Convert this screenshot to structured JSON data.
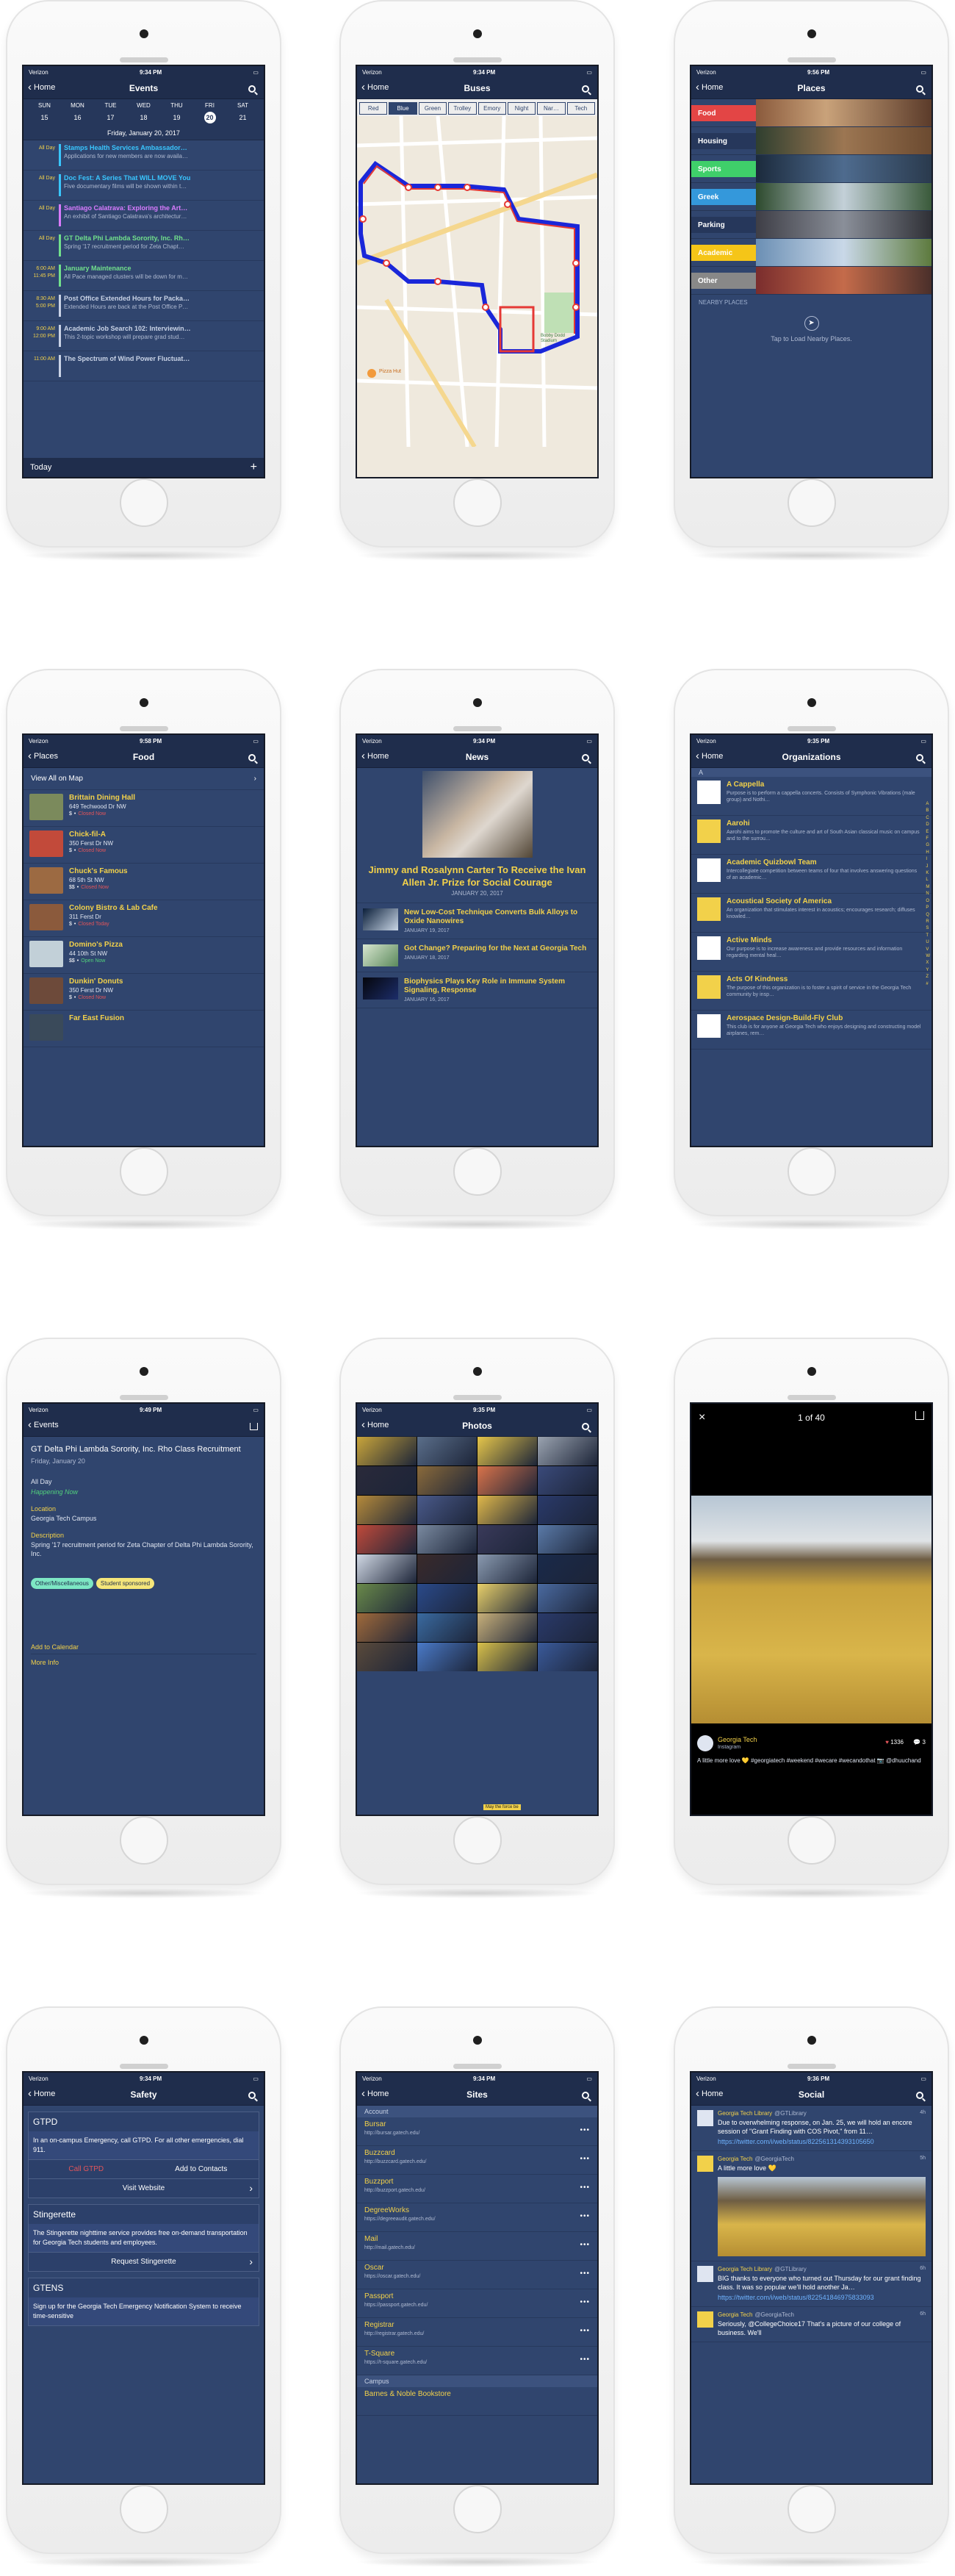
{
  "status": {
    "carrier": "Verizon",
    "times": [
      "9:34 PM",
      "9:34 PM",
      "9:56 PM",
      "9:58 PM",
      "9:34 PM",
      "9:35 PM",
      "9:49 PM",
      "9:35 PM",
      "",
      "9:34 PM",
      "9:34 PM",
      "9:36 PM"
    ]
  },
  "events": {
    "back": "Home",
    "title": "Events",
    "days": [
      "SUN",
      "MON",
      "TUE",
      "WED",
      "THU",
      "FRI",
      "SAT"
    ],
    "nums": [
      "15",
      "16",
      "17",
      "18",
      "19",
      "20",
      "21"
    ],
    "date": "Friday, January 20, 2017",
    "items": [
      {
        "time": "All Day",
        "title": "Stamps Health Services Ambassador…",
        "desc": "Applications for new members are now availa…",
        "color": "#39c6ff"
      },
      {
        "time": "All Day",
        "title": "Doc Fest: A Series That WILL MOVE You",
        "desc": "Five documentary films will be shown within t…",
        "color": "#39c6ff"
      },
      {
        "time": "All Day",
        "title": "Santiago Calatrava: Exploring the Art…",
        "desc": "An exhibit of Santiago Calatrava's architectur…",
        "color": "#d97bff"
      },
      {
        "time": "All Day",
        "title": "GT Delta Phi Lambda Sorority, Inc. Rh…",
        "desc": "Spring '17 recruitment period for Zeta Chapt…",
        "color": "#71e08c"
      },
      {
        "time": "6:00 AM\n11:45 PM",
        "title": "January Maintenance",
        "desc": "All Pace managed clusters will be down for m…",
        "color": "#71e08c"
      },
      {
        "time": "8:30 AM\n5:00 PM",
        "title": "Post Office Extended Hours for Packa…",
        "desc": "Extended Hours are back at the Post Office P…",
        "color": "#c9d3e6"
      },
      {
        "time": "9:00 AM\n12:00 PM",
        "title": "Academic Job Search 102: Interviewin…",
        "desc": "This 2-topic workshop will prepare grad stud…",
        "color": "#c9d3e6"
      },
      {
        "time": "11:00 AM",
        "title": "The Spectrum of Wind Power Fluctuat…",
        "desc": "",
        "color": "#c9d3e6"
      }
    ],
    "today": "Today",
    "add": "+"
  },
  "buses": {
    "back": "Home",
    "title": "Buses",
    "tabs": [
      "Red",
      "Blue",
      "Green",
      "Trolley",
      "Emory",
      "Night",
      "Nar…",
      "Tech"
    ],
    "active": "Blue",
    "map_labels": [
      "Pizza Hut",
      "Bobby Dodd Stadium"
    ]
  },
  "places": {
    "back": "Home",
    "title": "Places",
    "items": [
      {
        "label": "Food",
        "color": "#e34545"
      },
      {
        "label": "Housing",
        "color": "#26375b"
      },
      {
        "label": "Sports",
        "color": "#3fcf6a"
      },
      {
        "label": "Greek",
        "color": "#3498db"
      },
      {
        "label": "Parking",
        "color": "#26375b"
      },
      {
        "label": "Academic",
        "color": "#f5c518"
      },
      {
        "label": "Other",
        "color": "#888888"
      }
    ],
    "nearby": "NEARBY PLACES",
    "tap": "Tap to Load Nearby Places."
  },
  "food": {
    "back": "Places",
    "title": "Food",
    "view_all": "View All on Map",
    "items": [
      {
        "name": "Brittain Dining Hall",
        "addr": "649 Techwood Dr NW",
        "price": "$",
        "status": "Closed Now",
        "open": false
      },
      {
        "name": "Chick-fil-A",
        "addr": "350 Ferst Dr NW",
        "price": "$",
        "status": "Closed Now",
        "open": false
      },
      {
        "name": "Chuck's Famous",
        "addr": "68 5th St NW",
        "price": "$$",
        "status": "Closed Now",
        "open": false
      },
      {
        "name": "Colony Bistro & Lab Cafe",
        "addr": "311 Ferst Dr",
        "price": "$",
        "status": "Closed Today",
        "open": false
      },
      {
        "name": "Domino's Pizza",
        "addr": "44 10th St NW",
        "price": "$$",
        "status": "Open Now",
        "open": true
      },
      {
        "name": "Dunkin' Donuts",
        "addr": "350 Ferst Dr NW",
        "price": "$",
        "status": "Closed Now",
        "open": false
      },
      {
        "name": "Far East Fusion",
        "addr": "",
        "price": "",
        "status": "",
        "open": false
      }
    ]
  },
  "news": {
    "back": "Home",
    "title": "News",
    "hero_title": "Jimmy and Rosalynn Carter To Receive the Ivan Allen Jr. Prize for Social Courage",
    "hero_date": "JANUARY 20, 2017",
    "items": [
      {
        "title": "New Low-Cost Technique Converts Bulk Alloys to Oxide Nanowires",
        "date": "JANUARY 19, 2017"
      },
      {
        "title": "Got Change? Preparing for the Next at Georgia Tech",
        "date": "JANUARY 18, 2017"
      },
      {
        "title": "Biophysics Plays Key Role in Immune System Signaling, Response",
        "date": "JANUARY 16, 2017"
      }
    ]
  },
  "orgs": {
    "back": "Home",
    "title": "Organizations",
    "section": "A",
    "az": [
      "A",
      "B",
      "C",
      "D",
      "E",
      "F",
      "G",
      "H",
      "I",
      "J",
      "K",
      "L",
      "M",
      "N",
      "O",
      "P",
      "Q",
      "R",
      "S",
      "T",
      "U",
      "V",
      "W",
      "X",
      "Y",
      "Z",
      "#"
    ],
    "items": [
      {
        "name": "A Cappella",
        "desc": "Purpose is to perform a cappella concerts. Consists of Symphonic Vibrations (male group) and Nothi…"
      },
      {
        "name": "Aarohi",
        "desc": "Aarohi aims to promote the culture and art of South Asian classical music on campus and to the surrou…"
      },
      {
        "name": "Academic Quizbowl Team",
        "desc": "Intercollegiate competition between teams of four that involves answering questions of an academic…"
      },
      {
        "name": "Acoustical Society of America",
        "desc": "An organization that stimulates interest in acoustics; encourages research; diffuses knowled…"
      },
      {
        "name": "Active Minds",
        "desc": "Our purpose is to increase awareness and provide resources and information regarding mental heal…"
      },
      {
        "name": "Acts Of Kindness",
        "desc": "The purpose of this organization is to foster a spirit of service in the Georgia Tech community by insp…"
      },
      {
        "name": "Aerospace Design-Build-Fly Club",
        "desc": "This club is for anyone at Georgia Tech who enjoys designing and constructing model airplanes, rem…"
      }
    ]
  },
  "detail": {
    "back": "Events",
    "title": "GT Delta Phi Lambda Sorority, Inc. Rho Class Recruitment",
    "date": "Friday, January 20",
    "when": "All Day",
    "happening": "Happening Now",
    "loc_label": "Location",
    "loc": "Georgia Tech Campus",
    "desc_label": "Description",
    "desc": "Spring '17 recruitment period for Zeta Chapter of Delta Phi Lambda Sorority, Inc.",
    "tags": [
      "Other/Miscellaneous",
      "Student sponsored"
    ],
    "add_cal": "Add to Calendar",
    "more": "More Info"
  },
  "photos": {
    "back": "Home",
    "title": "Photos",
    "caption": "May the force be"
  },
  "viewer": {
    "counter": "1 of 40",
    "user": "Georgia Tech",
    "source": "Instagram",
    "likes": "1336",
    "comments": "3",
    "caption": "A little more love 💛 #georgiatech #weekend #wecare #wecandothat 📷 @dhuuchand"
  },
  "safety": {
    "back": "Home",
    "title": "Safety",
    "cards": [
      {
        "head": "GTPD",
        "body": "In an on-campus Emergency, call GTPD. For all other emergencies, dial 911.",
        "btn1": "Call GTPD",
        "btn2": "Add to Contacts",
        "action": "Visit Website"
      },
      {
        "head": "Stingerette",
        "body": "The Stingerette nighttime service provides free on-demand transportation for Georgia Tech students and employees.",
        "action": "Request Stingerette"
      },
      {
        "head": "GTENS",
        "body": "Sign up for the Georgia Tech Emergency Notification System to receive time-sensitive"
      }
    ]
  },
  "sites": {
    "back": "Home",
    "title": "Sites",
    "group1": "Account",
    "group2": "Campus",
    "items": [
      {
        "name": "Bursar",
        "url": "http://bursar.gatech.edu/"
      },
      {
        "name": "Buzzcard",
        "url": "http://buzzcard.gatech.edu/"
      },
      {
        "name": "Buzzport",
        "url": "http://buzzport.gatech.edu/"
      },
      {
        "name": "DegreeWorks",
        "url": "https://degreeaudit.gatech.edu/"
      },
      {
        "name": "Mail",
        "url": "http://mail.gatech.edu/"
      },
      {
        "name": "Oscar",
        "url": "https://oscar.gatech.edu/"
      },
      {
        "name": "Passport",
        "url": "https://passport.gatech.edu/"
      },
      {
        "name": "Registrar",
        "url": "http://registrar.gatech.edu/"
      },
      {
        "name": "T-Square",
        "url": "https://t-square.gatech.edu/"
      }
    ],
    "campus_first": "Barnes & Noble Bookstore"
  },
  "social": {
    "back": "Home",
    "title": "Social",
    "items": [
      {
        "user": "Georgia Tech Library",
        "handle": "@GTLibrary",
        "ago": "4h",
        "text": "Due to overwhelming response, on Jan. 25, we will hold an encore session of \"Grant Finding with COS Pivot,\" from 11…",
        "link": "https://twitter.com/i/web/status/822561314393105650"
      },
      {
        "user": "Georgia Tech",
        "handle": "@GeorgiaTech",
        "ago": "5h",
        "text": "A little more love 💛",
        "link": ""
      },
      {
        "user": "Georgia Tech Library",
        "handle": "@GTLibrary",
        "ago": "6h",
        "text": "BIG thanks to everyone who turned out Thursday for our grant finding class. It was so popular we'll hold another Ja…",
        "link": "https://twitter.com/i/web/status/822541846975833093"
      },
      {
        "user": "Georgia Tech",
        "handle": "@GeorgiaTech",
        "ago": "6h",
        "text": "Seriously, @CollegeChoice17 That's a picture of our college of business. We'll",
        "link": ""
      }
    ]
  }
}
